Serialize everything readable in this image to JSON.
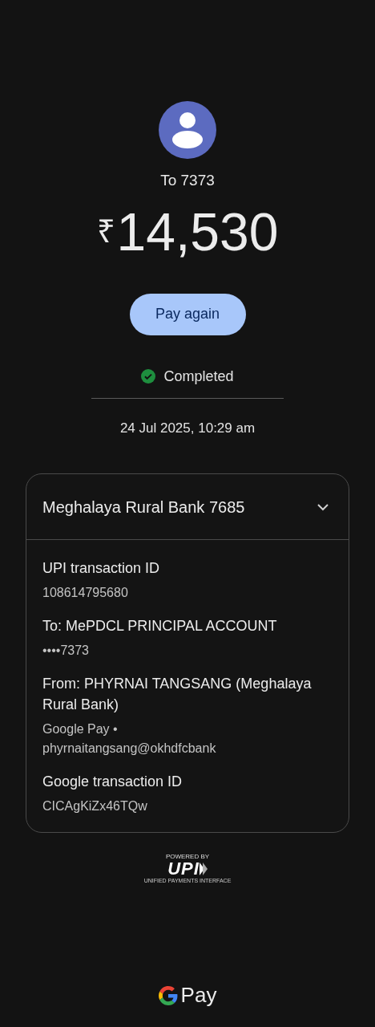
{
  "recipient": {
    "label": "To 7373"
  },
  "amount": {
    "currency": "₹",
    "value": "14,530"
  },
  "pay_again_button": "Pay again",
  "status": {
    "label": "Completed",
    "kind": "success"
  },
  "datetime": "24 Jul 2025, 10:29 am",
  "card": {
    "title": "Meghalaya Rural Bank 7685",
    "details": [
      {
        "label": "UPI transaction ID",
        "lines": [
          "108614795680"
        ]
      },
      {
        "label": "To: MePDCL PRINCIPAL ACCOUNT",
        "lines": [
          "••••7373"
        ]
      },
      {
        "label": "From: PHYRNAI TANGSANG (Meghalaya Rural Bank)",
        "lines": [
          "Google Pay •",
          "phyrnaitangsang@okhdfcbank"
        ]
      },
      {
        "label": "Google transaction ID",
        "lines": [
          "CICAgKiZx46TQw"
        ]
      }
    ]
  },
  "upi_badge": {
    "top": "POWERED BY",
    "mark": "UPI",
    "bottom": "UNIFIED PAYMENTS INTERFACE"
  },
  "brand": {
    "word": "Pay"
  }
}
